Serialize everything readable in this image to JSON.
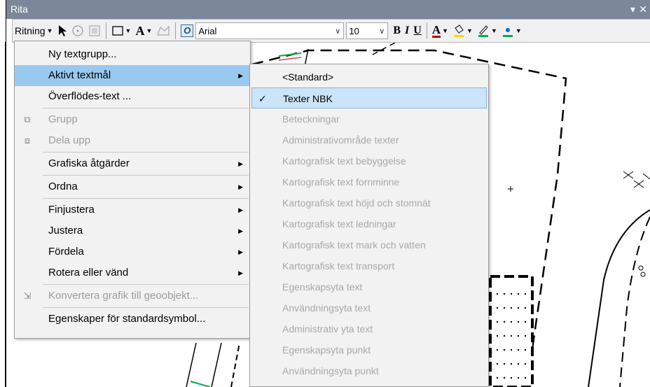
{
  "window": {
    "title": "Rita",
    "controls": [
      "▾",
      "✕"
    ]
  },
  "toolbar": {
    "drawing_menu_label": "Ritning",
    "font_name": "Arial",
    "font_size": "10",
    "bold_label": "B",
    "italic_label": "I",
    "underline_label": "U",
    "font_color_label": "A",
    "text_tool_label": "A",
    "font_icon_label": "O"
  },
  "main_menu": {
    "items": [
      {
        "label": "Ny textgrupp...",
        "disabled": false
      },
      {
        "label": "Aktivt textmål",
        "disabled": false,
        "submenu": true,
        "highlight": true
      },
      {
        "label": "Överflödes-text ...",
        "disabled": false
      },
      {
        "label": "Grupp",
        "disabled": true,
        "icon": "group-icon"
      },
      {
        "label": "Dela upp",
        "disabled": true,
        "icon": "ungroup-icon"
      },
      {
        "label": "Grafiska åtgärder",
        "disabled": false,
        "submenu": true
      },
      {
        "label": "Ordna",
        "disabled": false,
        "submenu": true
      },
      {
        "label": "Finjustera",
        "disabled": false,
        "submenu": true
      },
      {
        "label": "Justera",
        "disabled": false,
        "submenu": true
      },
      {
        "label": "Fördela",
        "disabled": false,
        "submenu": true
      },
      {
        "label": "Rotera eller vänd",
        "disabled": false,
        "submenu": true
      },
      {
        "label": "Konvertera grafik till geoobjekt...",
        "disabled": true,
        "icon": "convert-icon"
      },
      {
        "label": "Egenskaper för standardsymbol...",
        "disabled": false
      }
    ]
  },
  "sub_menu": {
    "items": [
      {
        "label": "<Standard>",
        "disabled": false
      },
      {
        "label": "Texter NBK",
        "disabled": false,
        "checked": true
      },
      {
        "label": "Beteckningar",
        "disabled": true
      },
      {
        "label": "Administrativområde texter",
        "disabled": true
      },
      {
        "label": "Kartografisk text bebyggelse",
        "disabled": true
      },
      {
        "label": "Kartografisk text fornminne",
        "disabled": true
      },
      {
        "label": "Kartografisk text höjd och stomnät",
        "disabled": true
      },
      {
        "label": "Kartografisk text ledningar",
        "disabled": true
      },
      {
        "label": "Kartografisk text mark och vatten",
        "disabled": true
      },
      {
        "label": "Kartografisk text transport",
        "disabled": true
      },
      {
        "label": "Egenskapsyta text",
        "disabled": true
      },
      {
        "label": "Användningsyta text",
        "disabled": true
      },
      {
        "label": "Administrativ yta text",
        "disabled": true
      },
      {
        "label": "Egenskapsyta punkt",
        "disabled": true
      },
      {
        "label": "Användningsyta punkt",
        "disabled": true
      }
    ]
  },
  "colors": {
    "title_bar": "#7a8899",
    "menu_bg": "#f2f2f2",
    "highlight": "#99c9ef",
    "checked_bg": "#cce4f7",
    "disabled_text": "#9d9d9d",
    "highlight_color_yellow": "#ffd800",
    "line_color_green": "#00b050",
    "font_color_red": "#c00000",
    "fill_color_blue": "#0070c0"
  }
}
